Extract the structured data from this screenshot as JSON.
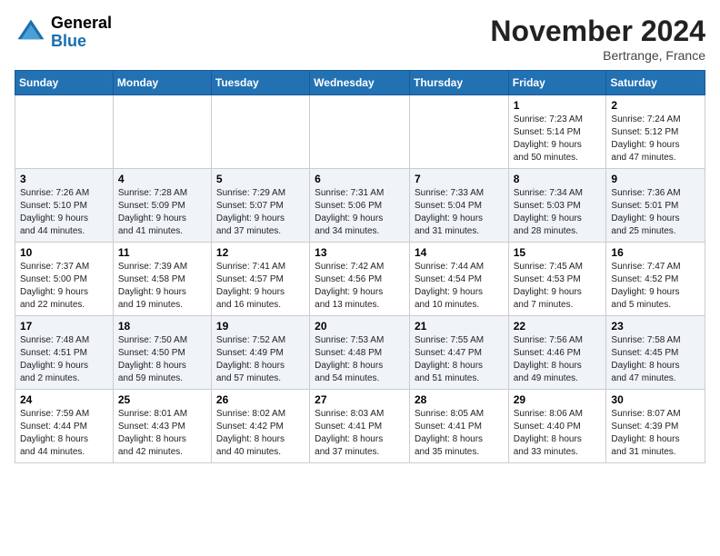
{
  "logo": {
    "general": "General",
    "blue": "Blue"
  },
  "title": "November 2024",
  "location": "Bertrange, France",
  "weekdays": [
    "Sunday",
    "Monday",
    "Tuesday",
    "Wednesday",
    "Thursday",
    "Friday",
    "Saturday"
  ],
  "weeks": [
    [
      {
        "day": "",
        "info": ""
      },
      {
        "day": "",
        "info": ""
      },
      {
        "day": "",
        "info": ""
      },
      {
        "day": "",
        "info": ""
      },
      {
        "day": "",
        "info": ""
      },
      {
        "day": "1",
        "info": "Sunrise: 7:23 AM\nSunset: 5:14 PM\nDaylight: 9 hours\nand 50 minutes."
      },
      {
        "day": "2",
        "info": "Sunrise: 7:24 AM\nSunset: 5:12 PM\nDaylight: 9 hours\nand 47 minutes."
      }
    ],
    [
      {
        "day": "3",
        "info": "Sunrise: 7:26 AM\nSunset: 5:10 PM\nDaylight: 9 hours\nand 44 minutes."
      },
      {
        "day": "4",
        "info": "Sunrise: 7:28 AM\nSunset: 5:09 PM\nDaylight: 9 hours\nand 41 minutes."
      },
      {
        "day": "5",
        "info": "Sunrise: 7:29 AM\nSunset: 5:07 PM\nDaylight: 9 hours\nand 37 minutes."
      },
      {
        "day": "6",
        "info": "Sunrise: 7:31 AM\nSunset: 5:06 PM\nDaylight: 9 hours\nand 34 minutes."
      },
      {
        "day": "7",
        "info": "Sunrise: 7:33 AM\nSunset: 5:04 PM\nDaylight: 9 hours\nand 31 minutes."
      },
      {
        "day": "8",
        "info": "Sunrise: 7:34 AM\nSunset: 5:03 PM\nDaylight: 9 hours\nand 28 minutes."
      },
      {
        "day": "9",
        "info": "Sunrise: 7:36 AM\nSunset: 5:01 PM\nDaylight: 9 hours\nand 25 minutes."
      }
    ],
    [
      {
        "day": "10",
        "info": "Sunrise: 7:37 AM\nSunset: 5:00 PM\nDaylight: 9 hours\nand 22 minutes."
      },
      {
        "day": "11",
        "info": "Sunrise: 7:39 AM\nSunset: 4:58 PM\nDaylight: 9 hours\nand 19 minutes."
      },
      {
        "day": "12",
        "info": "Sunrise: 7:41 AM\nSunset: 4:57 PM\nDaylight: 9 hours\nand 16 minutes."
      },
      {
        "day": "13",
        "info": "Sunrise: 7:42 AM\nSunset: 4:56 PM\nDaylight: 9 hours\nand 13 minutes."
      },
      {
        "day": "14",
        "info": "Sunrise: 7:44 AM\nSunset: 4:54 PM\nDaylight: 9 hours\nand 10 minutes."
      },
      {
        "day": "15",
        "info": "Sunrise: 7:45 AM\nSunset: 4:53 PM\nDaylight: 9 hours\nand 7 minutes."
      },
      {
        "day": "16",
        "info": "Sunrise: 7:47 AM\nSunset: 4:52 PM\nDaylight: 9 hours\nand 5 minutes."
      }
    ],
    [
      {
        "day": "17",
        "info": "Sunrise: 7:48 AM\nSunset: 4:51 PM\nDaylight: 9 hours\nand 2 minutes."
      },
      {
        "day": "18",
        "info": "Sunrise: 7:50 AM\nSunset: 4:50 PM\nDaylight: 8 hours\nand 59 minutes."
      },
      {
        "day": "19",
        "info": "Sunrise: 7:52 AM\nSunset: 4:49 PM\nDaylight: 8 hours\nand 57 minutes."
      },
      {
        "day": "20",
        "info": "Sunrise: 7:53 AM\nSunset: 4:48 PM\nDaylight: 8 hours\nand 54 minutes."
      },
      {
        "day": "21",
        "info": "Sunrise: 7:55 AM\nSunset: 4:47 PM\nDaylight: 8 hours\nand 51 minutes."
      },
      {
        "day": "22",
        "info": "Sunrise: 7:56 AM\nSunset: 4:46 PM\nDaylight: 8 hours\nand 49 minutes."
      },
      {
        "day": "23",
        "info": "Sunrise: 7:58 AM\nSunset: 4:45 PM\nDaylight: 8 hours\nand 47 minutes."
      }
    ],
    [
      {
        "day": "24",
        "info": "Sunrise: 7:59 AM\nSunset: 4:44 PM\nDaylight: 8 hours\nand 44 minutes."
      },
      {
        "day": "25",
        "info": "Sunrise: 8:01 AM\nSunset: 4:43 PM\nDaylight: 8 hours\nand 42 minutes."
      },
      {
        "day": "26",
        "info": "Sunrise: 8:02 AM\nSunset: 4:42 PM\nDaylight: 8 hours\nand 40 minutes."
      },
      {
        "day": "27",
        "info": "Sunrise: 8:03 AM\nSunset: 4:41 PM\nDaylight: 8 hours\nand 37 minutes."
      },
      {
        "day": "28",
        "info": "Sunrise: 8:05 AM\nSunset: 4:41 PM\nDaylight: 8 hours\nand 35 minutes."
      },
      {
        "day": "29",
        "info": "Sunrise: 8:06 AM\nSunset: 4:40 PM\nDaylight: 8 hours\nand 33 minutes."
      },
      {
        "day": "30",
        "info": "Sunrise: 8:07 AM\nSunset: 4:39 PM\nDaylight: 8 hours\nand 31 minutes."
      }
    ]
  ]
}
